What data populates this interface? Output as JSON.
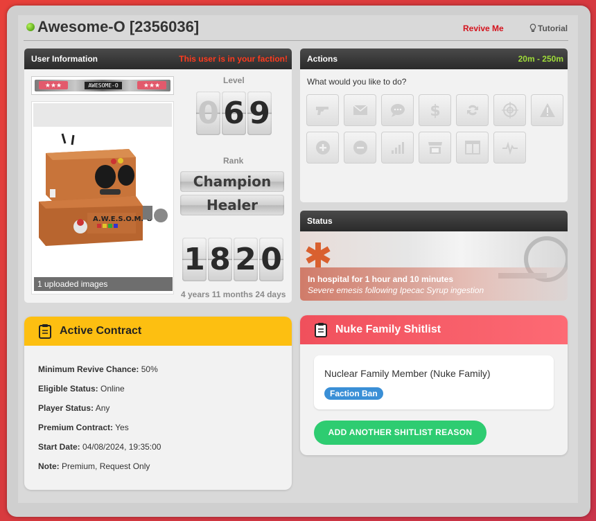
{
  "header": {
    "title": "Awesome-O [2356036]",
    "revive_link": "Revive Me",
    "tutorial": "Tutorial"
  },
  "user_info": {
    "heading": "User Information",
    "faction_notice": "This user is in your faction!",
    "banner_name": "AWESOME-O",
    "banner_stars": "★★★",
    "image_caption": "1 uploaded images",
    "level_label": "Level",
    "level_digits": [
      "0",
      "6",
      "9"
    ],
    "rank_label": "Rank",
    "rank_primary": "Champion",
    "rank_secondary": "Healer",
    "age_digits": [
      "1",
      "8",
      "2",
      "0"
    ],
    "age_text": "4 years 11 months 24 days"
  },
  "actions": {
    "heading": "Actions",
    "cost": "20m - 250m",
    "prompt": "What would you like to do?",
    "buttons": [
      {
        "icon": "gun-icon"
      },
      {
        "icon": "mail-icon"
      },
      {
        "icon": "chat-icon"
      },
      {
        "icon": "dollar-icon"
      },
      {
        "icon": "trade-icon"
      },
      {
        "icon": "target-icon"
      },
      {
        "icon": "warning-icon"
      },
      {
        "icon": "plus-icon"
      },
      {
        "icon": "minus-icon"
      },
      {
        "icon": "stats-icon"
      },
      {
        "icon": "shop-icon"
      },
      {
        "icon": "display-icon"
      },
      {
        "icon": "pulse-icon"
      }
    ]
  },
  "status": {
    "heading": "Status",
    "title": "In hospital for 1 hour and 10 minutes",
    "description": "Severe emesis following Ipecac Syrup ingestion"
  },
  "contract": {
    "heading": "Active Contract",
    "rows": [
      {
        "label": "Minimum Revive Chance:",
        "value": "50%"
      },
      {
        "label": "Eligible Status:",
        "value": "Online"
      },
      {
        "label": "Player Status:",
        "value": "Any"
      },
      {
        "label": "Premium Contract:",
        "value": "Yes"
      },
      {
        "label": "Start Date:",
        "value": "04/08/2024, 19:35:00"
      },
      {
        "label": "Note:",
        "value": "Premium, Request Only"
      }
    ]
  },
  "shitlist": {
    "heading": "Nuke Family Shitlist",
    "entry_name": "Nuclear Family Member (Nuke Family)",
    "entry_tag": "Faction Ban",
    "add_button": "ADD ANOTHER SHITLIST REASON"
  },
  "colors": {
    "online": "#5aa818",
    "faction_notice": "#ff3b1e",
    "cost": "#9fdc3a",
    "revive_link": "#d4121c",
    "contract_header": "#fdbf11",
    "shitlist_header": "#f0505c",
    "tag": "#3a8fd6",
    "add_button": "#2ecc71"
  }
}
